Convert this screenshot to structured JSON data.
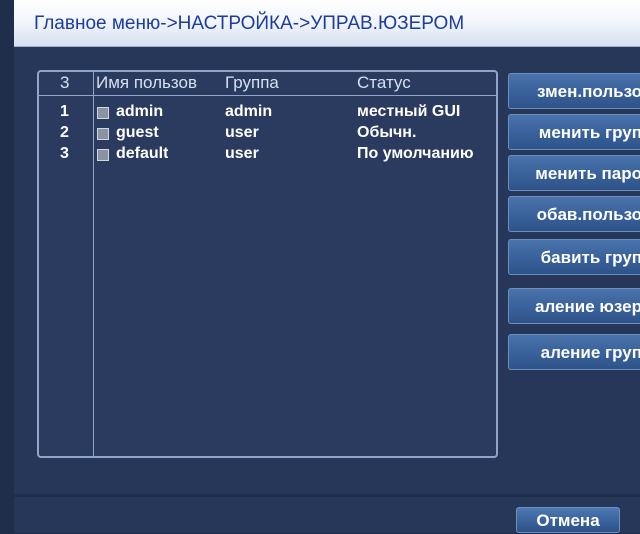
{
  "title": "Главное меню->НАСТРОЙКА->УПРАВ.ЮЗЕРОМ",
  "table": {
    "headers": {
      "num": "3",
      "name": "Имя пользов",
      "group": "Группа",
      "status": "Статус"
    },
    "rows": [
      {
        "num": "1",
        "name": "admin",
        "group": "admin",
        "status": "местный GUI",
        "checked": false
      },
      {
        "num": "2",
        "name": "guest",
        "group": "user",
        "status": "Обычн.",
        "checked": false
      },
      {
        "num": "3",
        "name": "default",
        "group": "user",
        "status": "По умолчанию",
        "checked": false
      }
    ]
  },
  "side_buttons": [
    "змен.пользо",
    "менить груп",
    "менить паро",
    "обав.пользо",
    "бавить груп",
    "аление юзер",
    "аление груп"
  ],
  "cancel_label": "Отмена",
  "colors": {
    "background": "#1f2f4b",
    "title_text": "#1c3ca0",
    "button": "#3a629c",
    "table_border": "#8fa6c8"
  }
}
